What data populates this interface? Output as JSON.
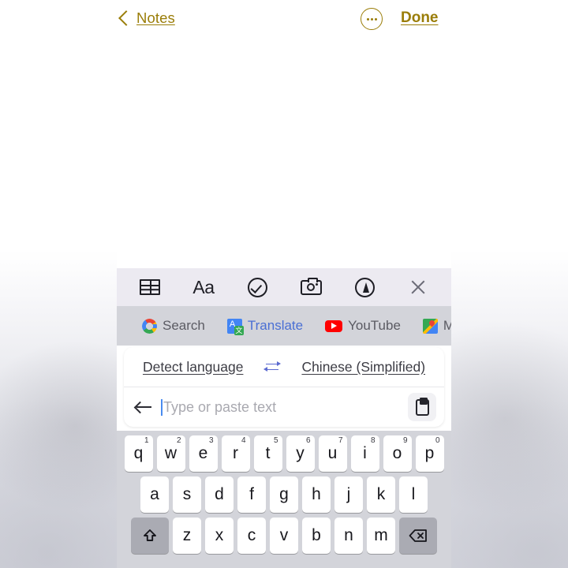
{
  "app": {
    "name": "Notes",
    "colors": {
      "accent_gold": "#9a7d08",
      "keyboard_bg": "#d3d4da",
      "toolbar_bg": "#eceaf1",
      "translate_blue": "#4a6fd4",
      "swap_blue": "#5b6ad0",
      "caret_blue": "#4a8cf0"
    }
  },
  "navbar": {
    "back_label": "Notes",
    "back_icon": "chevron-left-icon",
    "more_icon": "more-options-circle-icon",
    "done_label": "Done"
  },
  "format_toolbar": {
    "items": [
      {
        "name": "table-icon",
        "label": "",
        "icon": "table-icon"
      },
      {
        "name": "text-format-icon",
        "label": "Aa",
        "icon": "text-format-aa-icon"
      },
      {
        "name": "checklist-icon",
        "label": "",
        "icon": "checkmark-circle-icon"
      },
      {
        "name": "camera-icon",
        "label": "",
        "icon": "camera-icon"
      },
      {
        "name": "markup-pen-icon",
        "label": "",
        "icon": "pen-circle-icon"
      },
      {
        "name": "close-icon",
        "label": "",
        "icon": "close-x-icon"
      }
    ]
  },
  "suggestion_bar": {
    "items": [
      {
        "label": "Search",
        "icon": "google-g-icon",
        "accent": false
      },
      {
        "label": "Translate",
        "icon": "google-translate-icon",
        "accent": true
      },
      {
        "label": "YouTube",
        "icon": "youtube-icon",
        "accent": false
      },
      {
        "label": "Ma",
        "icon": "google-maps-icon",
        "accent": false
      }
    ]
  },
  "translate_card": {
    "source_language": "Detect language",
    "swap_icon": "swap-arrows-icon",
    "target_language": "Chinese (Simplified)",
    "back_icon": "back-arrow-icon",
    "input_value": "",
    "input_placeholder": "Type or paste text",
    "paste_icon": "clipboard-paste-icon"
  },
  "keyboard": {
    "row1": [
      {
        "key": "q",
        "num": "1"
      },
      {
        "key": "w",
        "num": "2"
      },
      {
        "key": "e",
        "num": "3"
      },
      {
        "key": "r",
        "num": "4"
      },
      {
        "key": "t",
        "num": "5"
      },
      {
        "key": "y",
        "num": "6"
      },
      {
        "key": "u",
        "num": "7"
      },
      {
        "key": "i",
        "num": "8"
      },
      {
        "key": "o",
        "num": "9"
      },
      {
        "key": "p",
        "num": "0"
      }
    ],
    "row2": [
      {
        "key": "a"
      },
      {
        "key": "s"
      },
      {
        "key": "d"
      },
      {
        "key": "f"
      },
      {
        "key": "g"
      },
      {
        "key": "h"
      },
      {
        "key": "j"
      },
      {
        "key": "k"
      },
      {
        "key": "l"
      }
    ],
    "row3": [
      {
        "key": "z"
      },
      {
        "key": "x"
      },
      {
        "key": "c"
      },
      {
        "key": "v"
      },
      {
        "key": "b"
      },
      {
        "key": "n"
      },
      {
        "key": "m"
      }
    ],
    "shift_icon": "shift-arrow-icon",
    "backspace_icon": "backspace-delete-icon"
  }
}
